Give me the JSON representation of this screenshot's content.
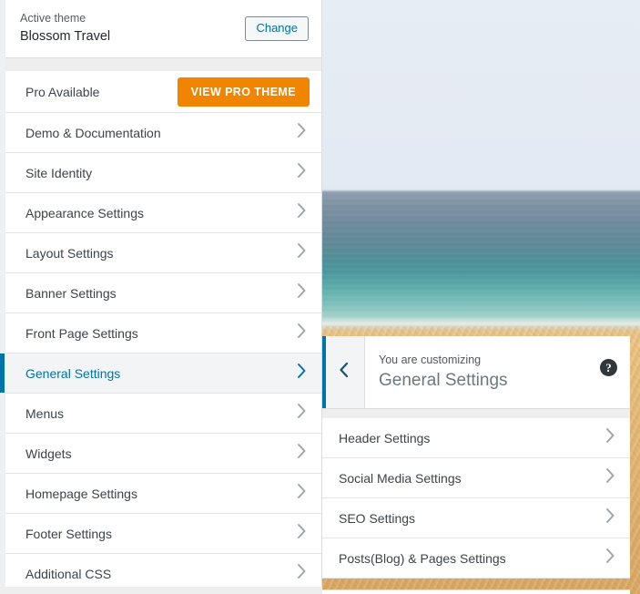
{
  "theme_header": {
    "active_theme_label": "Active theme",
    "theme_name": "Blossom Travel",
    "change_button": "Change"
  },
  "sidebar": {
    "pro_row": {
      "label": "Pro Available",
      "button": "VIEW PRO THEME"
    },
    "items": [
      {
        "label": "Demo & Documentation",
        "selected": false
      },
      {
        "label": "Site Identity",
        "selected": false
      },
      {
        "label": "Appearance Settings",
        "selected": false
      },
      {
        "label": "Layout Settings",
        "selected": false
      },
      {
        "label": "Banner Settings",
        "selected": false
      },
      {
        "label": "Front Page Settings",
        "selected": false
      },
      {
        "label": "General Settings",
        "selected": true
      },
      {
        "label": "Menus",
        "selected": false
      },
      {
        "label": "Widgets",
        "selected": false
      },
      {
        "label": "Homepage Settings",
        "selected": false
      },
      {
        "label": "Footer Settings",
        "selected": false
      },
      {
        "label": "Additional CSS",
        "selected": false
      }
    ]
  },
  "panel": {
    "back_icon": "chevron-left-icon",
    "customizing_label": "You are customizing",
    "title": "General Settings",
    "help_icon_glyph": "?",
    "items": [
      {
        "label": "Header Settings"
      },
      {
        "label": "Social Media Settings"
      },
      {
        "label": "SEO Settings"
      },
      {
        "label": "Posts(Blog) & Pages Settings"
      }
    ]
  },
  "preview": {
    "description": "beach-ocean-photo",
    "sky_color": "#e4ebf3",
    "deep_water_color": "#7d93a4",
    "shallow_water_color": "#5eacab",
    "sand_color": "#ecc07d"
  },
  "colors": {
    "accent_blue": "#0073aa",
    "pro_orange": "#f18500",
    "panel_bg": "#ffffff",
    "frame_gray": "#eeeeee",
    "text_dark": "#3c434a"
  }
}
